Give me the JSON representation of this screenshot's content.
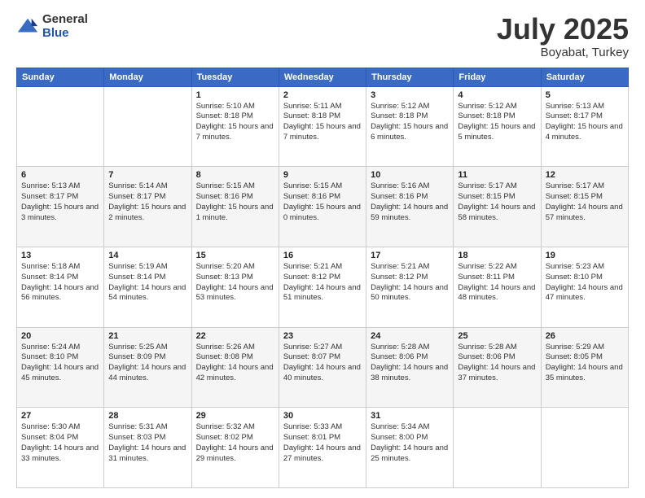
{
  "logo": {
    "general": "General",
    "blue": "Blue"
  },
  "title": {
    "month_year": "July 2025",
    "location": "Boyabat, Turkey"
  },
  "days_of_week": [
    "Sunday",
    "Monday",
    "Tuesday",
    "Wednesday",
    "Thursday",
    "Friday",
    "Saturday"
  ],
  "weeks": [
    [
      {
        "day": "",
        "sunrise": "",
        "sunset": "",
        "daylight": ""
      },
      {
        "day": "",
        "sunrise": "",
        "sunset": "",
        "daylight": ""
      },
      {
        "day": "1",
        "sunrise": "Sunrise: 5:10 AM",
        "sunset": "Sunset: 8:18 PM",
        "daylight": "Daylight: 15 hours and 7 minutes."
      },
      {
        "day": "2",
        "sunrise": "Sunrise: 5:11 AM",
        "sunset": "Sunset: 8:18 PM",
        "daylight": "Daylight: 15 hours and 7 minutes."
      },
      {
        "day": "3",
        "sunrise": "Sunrise: 5:12 AM",
        "sunset": "Sunset: 8:18 PM",
        "daylight": "Daylight: 15 hours and 6 minutes."
      },
      {
        "day": "4",
        "sunrise": "Sunrise: 5:12 AM",
        "sunset": "Sunset: 8:18 PM",
        "daylight": "Daylight: 15 hours and 5 minutes."
      },
      {
        "day": "5",
        "sunrise": "Sunrise: 5:13 AM",
        "sunset": "Sunset: 8:17 PM",
        "daylight": "Daylight: 15 hours and 4 minutes."
      }
    ],
    [
      {
        "day": "6",
        "sunrise": "Sunrise: 5:13 AM",
        "sunset": "Sunset: 8:17 PM",
        "daylight": "Daylight: 15 hours and 3 minutes."
      },
      {
        "day": "7",
        "sunrise": "Sunrise: 5:14 AM",
        "sunset": "Sunset: 8:17 PM",
        "daylight": "Daylight: 15 hours and 2 minutes."
      },
      {
        "day": "8",
        "sunrise": "Sunrise: 5:15 AM",
        "sunset": "Sunset: 8:16 PM",
        "daylight": "Daylight: 15 hours and 1 minute."
      },
      {
        "day": "9",
        "sunrise": "Sunrise: 5:15 AM",
        "sunset": "Sunset: 8:16 PM",
        "daylight": "Daylight: 15 hours and 0 minutes."
      },
      {
        "day": "10",
        "sunrise": "Sunrise: 5:16 AM",
        "sunset": "Sunset: 8:16 PM",
        "daylight": "Daylight: 14 hours and 59 minutes."
      },
      {
        "day": "11",
        "sunrise": "Sunrise: 5:17 AM",
        "sunset": "Sunset: 8:15 PM",
        "daylight": "Daylight: 14 hours and 58 minutes."
      },
      {
        "day": "12",
        "sunrise": "Sunrise: 5:17 AM",
        "sunset": "Sunset: 8:15 PM",
        "daylight": "Daylight: 14 hours and 57 minutes."
      }
    ],
    [
      {
        "day": "13",
        "sunrise": "Sunrise: 5:18 AM",
        "sunset": "Sunset: 8:14 PM",
        "daylight": "Daylight: 14 hours and 56 minutes."
      },
      {
        "day": "14",
        "sunrise": "Sunrise: 5:19 AM",
        "sunset": "Sunset: 8:14 PM",
        "daylight": "Daylight: 14 hours and 54 minutes."
      },
      {
        "day": "15",
        "sunrise": "Sunrise: 5:20 AM",
        "sunset": "Sunset: 8:13 PM",
        "daylight": "Daylight: 14 hours and 53 minutes."
      },
      {
        "day": "16",
        "sunrise": "Sunrise: 5:21 AM",
        "sunset": "Sunset: 8:12 PM",
        "daylight": "Daylight: 14 hours and 51 minutes."
      },
      {
        "day": "17",
        "sunrise": "Sunrise: 5:21 AM",
        "sunset": "Sunset: 8:12 PM",
        "daylight": "Daylight: 14 hours and 50 minutes."
      },
      {
        "day": "18",
        "sunrise": "Sunrise: 5:22 AM",
        "sunset": "Sunset: 8:11 PM",
        "daylight": "Daylight: 14 hours and 48 minutes."
      },
      {
        "day": "19",
        "sunrise": "Sunrise: 5:23 AM",
        "sunset": "Sunset: 8:10 PM",
        "daylight": "Daylight: 14 hours and 47 minutes."
      }
    ],
    [
      {
        "day": "20",
        "sunrise": "Sunrise: 5:24 AM",
        "sunset": "Sunset: 8:10 PM",
        "daylight": "Daylight: 14 hours and 45 minutes."
      },
      {
        "day": "21",
        "sunrise": "Sunrise: 5:25 AM",
        "sunset": "Sunset: 8:09 PM",
        "daylight": "Daylight: 14 hours and 44 minutes."
      },
      {
        "day": "22",
        "sunrise": "Sunrise: 5:26 AM",
        "sunset": "Sunset: 8:08 PM",
        "daylight": "Daylight: 14 hours and 42 minutes."
      },
      {
        "day": "23",
        "sunrise": "Sunrise: 5:27 AM",
        "sunset": "Sunset: 8:07 PM",
        "daylight": "Daylight: 14 hours and 40 minutes."
      },
      {
        "day": "24",
        "sunrise": "Sunrise: 5:28 AM",
        "sunset": "Sunset: 8:06 PM",
        "daylight": "Daylight: 14 hours and 38 minutes."
      },
      {
        "day": "25",
        "sunrise": "Sunrise: 5:28 AM",
        "sunset": "Sunset: 8:06 PM",
        "daylight": "Daylight: 14 hours and 37 minutes."
      },
      {
        "day": "26",
        "sunrise": "Sunrise: 5:29 AM",
        "sunset": "Sunset: 8:05 PM",
        "daylight": "Daylight: 14 hours and 35 minutes."
      }
    ],
    [
      {
        "day": "27",
        "sunrise": "Sunrise: 5:30 AM",
        "sunset": "Sunset: 8:04 PM",
        "daylight": "Daylight: 14 hours and 33 minutes."
      },
      {
        "day": "28",
        "sunrise": "Sunrise: 5:31 AM",
        "sunset": "Sunset: 8:03 PM",
        "daylight": "Daylight: 14 hours and 31 minutes."
      },
      {
        "day": "29",
        "sunrise": "Sunrise: 5:32 AM",
        "sunset": "Sunset: 8:02 PM",
        "daylight": "Daylight: 14 hours and 29 minutes."
      },
      {
        "day": "30",
        "sunrise": "Sunrise: 5:33 AM",
        "sunset": "Sunset: 8:01 PM",
        "daylight": "Daylight: 14 hours and 27 minutes."
      },
      {
        "day": "31",
        "sunrise": "Sunrise: 5:34 AM",
        "sunset": "Sunset: 8:00 PM",
        "daylight": "Daylight: 14 hours and 25 minutes."
      },
      {
        "day": "",
        "sunrise": "",
        "sunset": "",
        "daylight": ""
      },
      {
        "day": "",
        "sunrise": "",
        "sunset": "",
        "daylight": ""
      }
    ]
  ]
}
